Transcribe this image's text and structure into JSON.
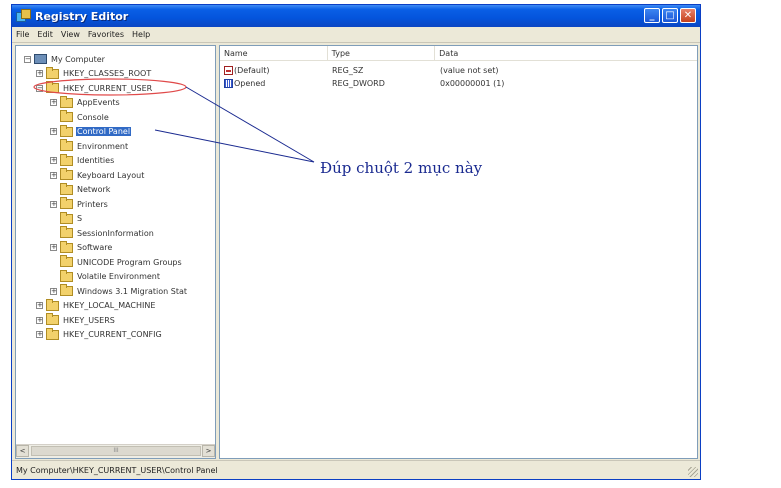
{
  "window": {
    "title": "Registry Editor"
  },
  "menu": [
    "File",
    "Edit",
    "View",
    "Favorites",
    "Help"
  ],
  "tree": [
    {
      "label": "My Computer",
      "level": 0,
      "expander": "−",
      "icon": "computer-icon"
    },
    {
      "label": "HKEY_CLASSES_ROOT",
      "level": 1,
      "expander": "+",
      "icon": "folder-icon"
    },
    {
      "label": "HKEY_CURRENT_USER",
      "level": 1,
      "expander": "−",
      "icon": "folder-icon"
    },
    {
      "label": "AppEvents",
      "level": 2,
      "expander": "+",
      "icon": "folder-icon"
    },
    {
      "label": "Console",
      "level": 2,
      "expander": "",
      "icon": "folder-icon"
    },
    {
      "label": "Control Panel",
      "level": 2,
      "expander": "+",
      "icon": "folder-icon",
      "selected": true
    },
    {
      "label": "Environment",
      "level": 2,
      "expander": "",
      "icon": "folder-icon"
    },
    {
      "label": "Identities",
      "level": 2,
      "expander": "+",
      "icon": "folder-icon"
    },
    {
      "label": "Keyboard Layout",
      "level": 2,
      "expander": "+",
      "icon": "folder-icon"
    },
    {
      "label": "Network",
      "level": 2,
      "expander": "",
      "icon": "folder-icon"
    },
    {
      "label": "Printers",
      "level": 2,
      "expander": "+",
      "icon": "folder-icon"
    },
    {
      "label": "S",
      "level": 2,
      "expander": "",
      "icon": "folder-icon"
    },
    {
      "label": "SessionInformation",
      "level": 2,
      "expander": "",
      "icon": "folder-icon"
    },
    {
      "label": "Software",
      "level": 2,
      "expander": "+",
      "icon": "folder-icon"
    },
    {
      "label": "UNICODE Program Groups",
      "level": 2,
      "expander": "",
      "icon": "folder-icon"
    },
    {
      "label": "Volatile Environment",
      "level": 2,
      "expander": "",
      "icon": "folder-icon"
    },
    {
      "label": "Windows 3.1 Migration Stat",
      "level": 2,
      "expander": "+",
      "icon": "folder-icon"
    },
    {
      "label": "HKEY_LOCAL_MACHINE",
      "level": 1,
      "expander": "+",
      "icon": "folder-icon"
    },
    {
      "label": "HKEY_USERS",
      "level": 1,
      "expander": "+",
      "icon": "folder-icon"
    },
    {
      "label": "HKEY_CURRENT_CONFIG",
      "level": 1,
      "expander": "+",
      "icon": "folder-icon"
    }
  ],
  "scrollbar": {
    "left": "<",
    "thumb": "III",
    "right": ">"
  },
  "values": {
    "columns": [
      "Name",
      "Type",
      "Data"
    ],
    "rows": [
      {
        "name": "(Default)",
        "type": "REG_SZ",
        "data": "(value not set)",
        "icon": "reg-sz-icon"
      },
      {
        "name": "Opened",
        "type": "REG_DWORD",
        "data": "0x00000001 (1)",
        "icon": "reg-dword-icon"
      }
    ]
  },
  "status": "My Computer\\HKEY_CURRENT_USER\\Control Panel",
  "annotation": {
    "text": "Đúp chuột 2 mục này",
    "color": "#1a2a90",
    "circle_color": "#e04a4a"
  }
}
